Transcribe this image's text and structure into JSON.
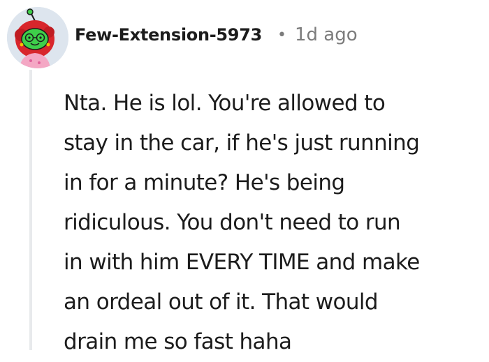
{
  "comment": {
    "author": "Few-Extension-5973",
    "separator": "•",
    "age": "1d ago",
    "avatar_icon": "reddit-snoo-avatar-icon",
    "body_lines": [
      "Nta. He is lol. You're allowed to",
      "stay in the car, if he's just running",
      "in for a minute? He's being",
      "ridiculous. You don't need to run",
      "in with him EVERY TIME and make",
      "an ordeal out of it. That would",
      "drain me so fast haha"
    ]
  },
  "colors": {
    "text": "#1c1c1c",
    "meta": "#7c7c7c",
    "thread_line": "#e8eaec",
    "avatar_bg": "#dde5ee",
    "avatar_head": "#3ecf4a",
    "avatar_hair": "#d8262c",
    "avatar_shirt": "#f4a7c4"
  }
}
